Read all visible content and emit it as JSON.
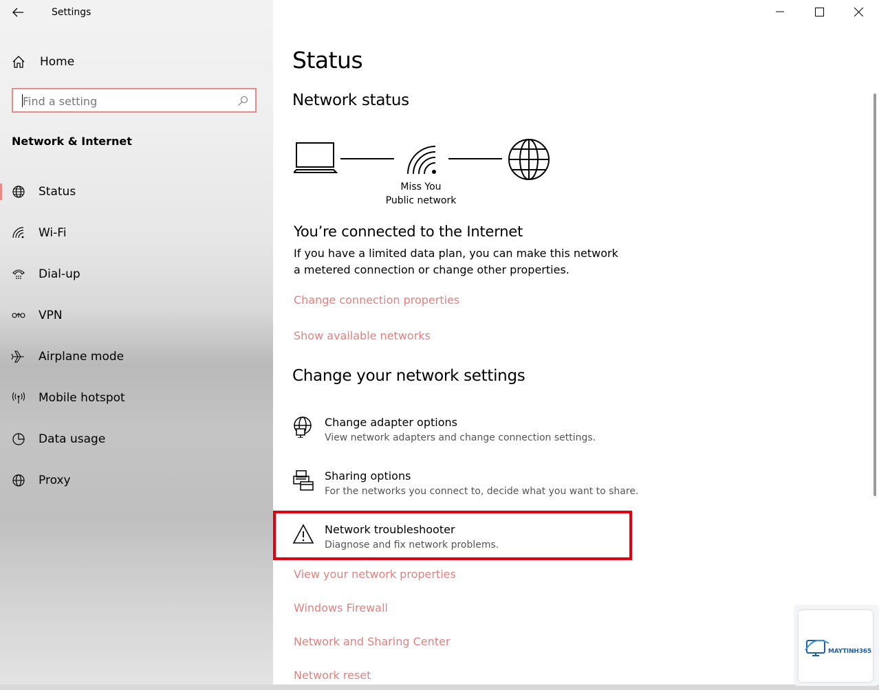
{
  "window": {
    "title": "Settings"
  },
  "sidebar": {
    "home_label": "Home",
    "search_placeholder": "Find a setting",
    "section_title": "Network & Internet",
    "items": [
      {
        "label": "Status",
        "icon": "globe-icon",
        "active": true
      },
      {
        "label": "Wi-Fi",
        "icon": "wifi-icon"
      },
      {
        "label": "Dial-up",
        "icon": "dialup-icon"
      },
      {
        "label": "VPN",
        "icon": "vpn-icon"
      },
      {
        "label": "Airplane mode",
        "icon": "airplane-icon"
      },
      {
        "label": "Mobile hotspot",
        "icon": "hotspot-icon"
      },
      {
        "label": "Data usage",
        "icon": "data-usage-icon"
      },
      {
        "label": "Proxy",
        "icon": "globe-icon"
      }
    ]
  },
  "main": {
    "page_title": "Status",
    "network_status_heading": "Network status",
    "network_name": "Miss You",
    "network_type": "Public network",
    "connected_title": "You’re connected to the Internet",
    "connected_desc": "If you have a limited data plan, you can make this network a metered connection or change other properties.",
    "links_top": [
      "Change connection properties",
      "Show available networks"
    ],
    "change_heading": "Change your network settings",
    "options": [
      {
        "title": "Change adapter options",
        "desc": "View network adapters and change connection settings.",
        "icon": "adapter-icon"
      },
      {
        "title": "Sharing options",
        "desc": "For the networks you connect to, decide what you want to share.",
        "icon": "sharing-icon"
      },
      {
        "title": "Network troubleshooter",
        "desc": "Diagnose and fix network problems.",
        "icon": "warning-icon"
      }
    ],
    "links_bottom": [
      "View your network properties",
      "Windows Firewall",
      "Network and Sharing Center",
      "Network reset"
    ]
  },
  "watermark": {
    "brand": "MAYTINH365"
  },
  "colors": {
    "accent_link": "#e0817f",
    "search_border": "#e9898a",
    "highlight_box": "#e3000f"
  }
}
